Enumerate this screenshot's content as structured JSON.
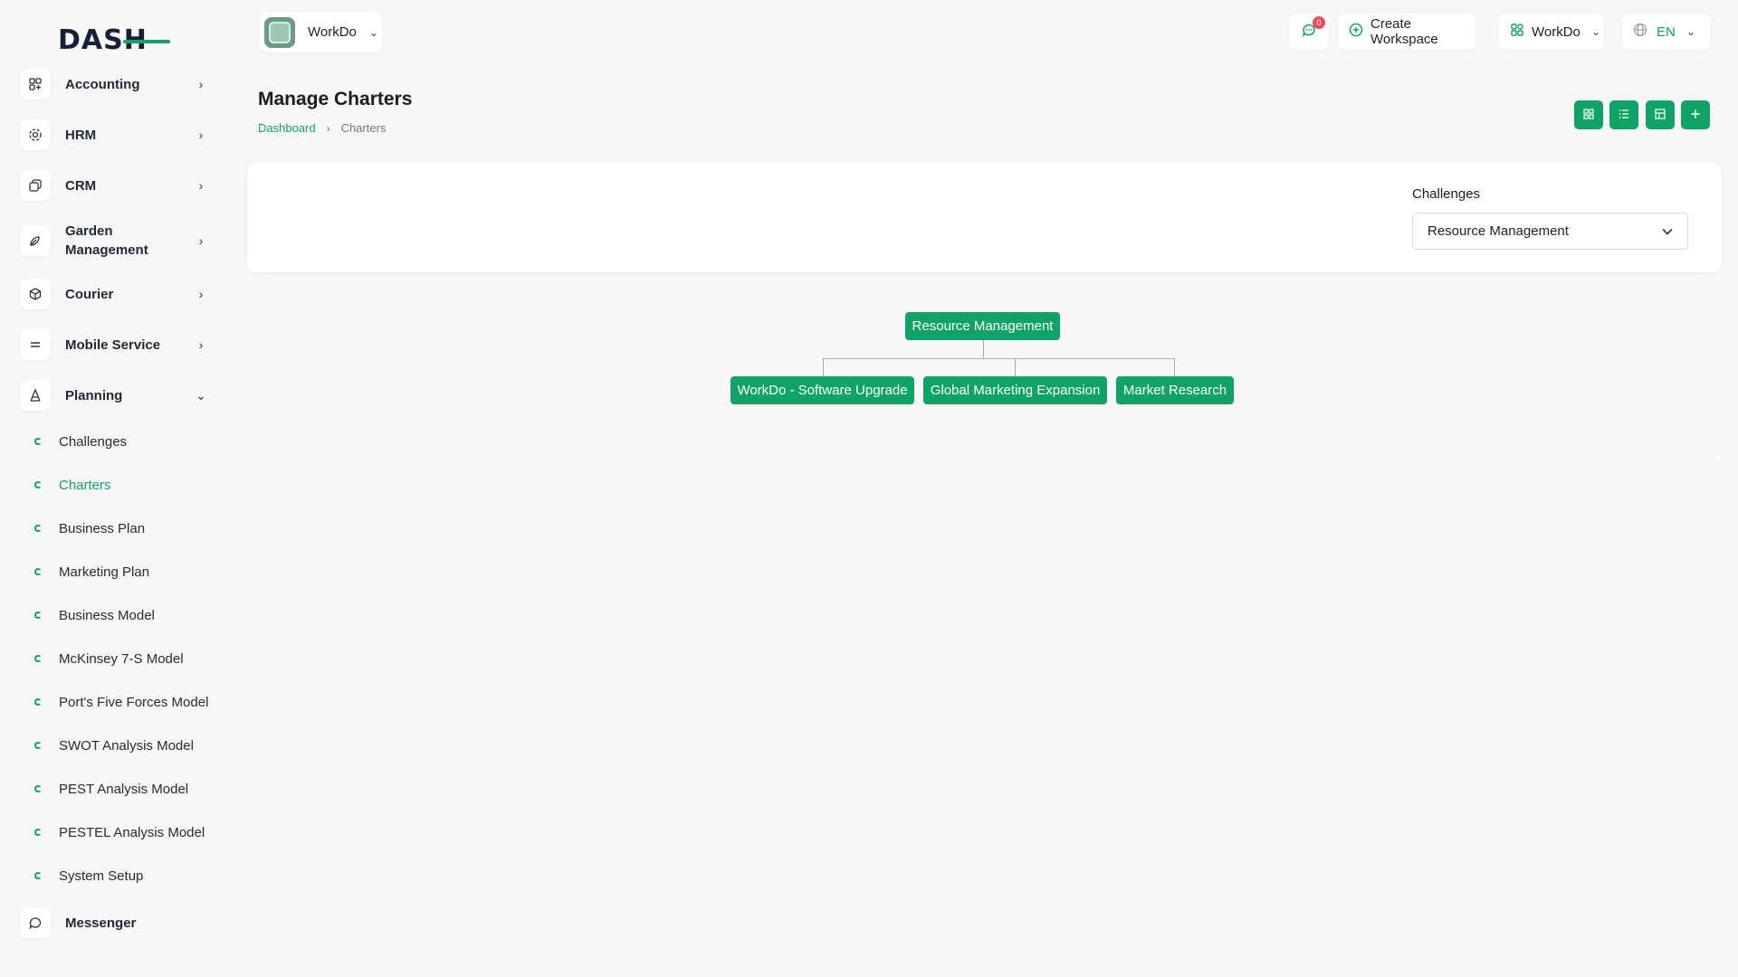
{
  "logo": {
    "text": "DASH"
  },
  "sidebar": {
    "items": [
      {
        "label": "Accounting",
        "icon": "accounting-icon",
        "expanded": false
      },
      {
        "label": "HRM",
        "icon": "hrm-icon",
        "expanded": false
      },
      {
        "label": "CRM",
        "icon": "crm-icon",
        "expanded": false
      },
      {
        "label": "Garden Management",
        "icon": "garden-icon",
        "expanded": false
      },
      {
        "label": "Courier",
        "icon": "courier-icon",
        "expanded": false
      },
      {
        "label": "Mobile Service",
        "icon": "mobile-service-icon",
        "expanded": false
      },
      {
        "label": "Planning",
        "icon": "planning-icon",
        "expanded": true
      },
      {
        "label": "Messenger",
        "icon": "messenger-icon"
      }
    ],
    "planning_sub": [
      {
        "label": "Challenges",
        "active": false
      },
      {
        "label": "Charters",
        "active": true
      },
      {
        "label": "Business Plan",
        "active": false
      },
      {
        "label": "Marketing Plan",
        "active": false
      },
      {
        "label": "Business Model",
        "active": false
      },
      {
        "label": "McKinsey 7-S Model",
        "active": false
      },
      {
        "label": "Port's Five Forces Model",
        "active": false
      },
      {
        "label": "SWOT Analysis Model",
        "active": false
      },
      {
        "label": "PEST Analysis Model",
        "active": false
      },
      {
        "label": "PESTEL Analysis Model",
        "active": false
      },
      {
        "label": "System Setup",
        "active": false
      }
    ]
  },
  "header": {
    "workspace_name": "WorkDo",
    "message_badge": "0",
    "create_workspace": "Create Workspace",
    "workspace_menu": "WorkDo",
    "language": "EN"
  },
  "page": {
    "title": "Manage Charters",
    "breadcrumb": {
      "home": "Dashboard",
      "current": "Charters"
    }
  },
  "filter": {
    "label": "Challenges",
    "selected": "Resource Management"
  },
  "chart": {
    "root": "Resource Management",
    "children": [
      "WorkDo - Software Upgrade",
      "Global Marketing Expansion",
      "Market Research"
    ]
  },
  "colors": {
    "accent": "#10a266",
    "badge": "#ef4a5a",
    "background": "#f7f7f7"
  }
}
